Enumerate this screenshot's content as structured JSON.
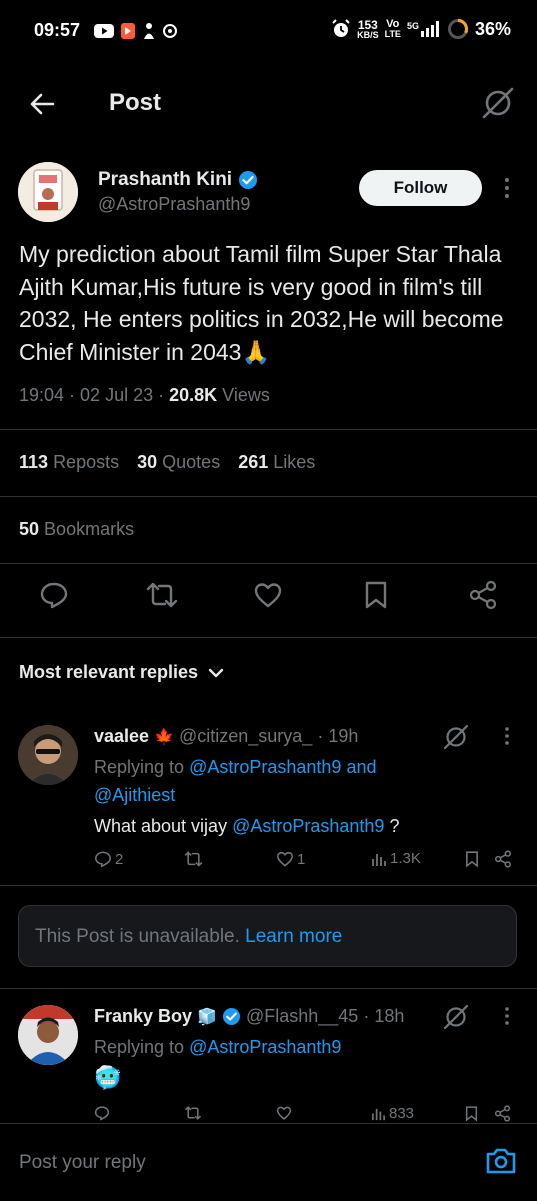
{
  "status_bar": {
    "time": "09:57",
    "net_speed_value": "153",
    "net_speed_unit": "KB/S",
    "volte_top": "Vo",
    "volte_bottom": "LTE",
    "network": "5G",
    "battery": "36%"
  },
  "header": {
    "title": "Post"
  },
  "post": {
    "author_name": "Prashanth Kini",
    "author_handle": "@AstroPrashanth9",
    "follow_label": "Follow",
    "text": "My prediction about Tamil film Super Star Thala Ajith Kumar,His future is very good in film's till 2032, He enters politics in 2032,He will become Chief Minister in 2043",
    "emoji": "🙏",
    "time": "19:04",
    "date": "02 Jul 23",
    "views_count": "20.8K",
    "views_label": "Views",
    "reposts_count": "113",
    "reposts_label": "Reposts",
    "quotes_count": "30",
    "quotes_label": "Quotes",
    "likes_count": "261",
    "likes_label": "Likes",
    "bookmarks_count": "50",
    "bookmarks_label": "Bookmarks"
  },
  "replies_sort": {
    "label": "Most relevant replies"
  },
  "replies": [
    {
      "name": "vaalee",
      "name_emoji": "🍁",
      "handle": "@citizen_surya_",
      "age": "19h",
      "replying_prefix": "Replying to",
      "replying_to_1": "@AstroPrashanth9",
      "replying_and": "and",
      "replying_to_2": "@Ajithiest",
      "text_before": "What about vijay",
      "mention": "@AstroPrashanth9",
      "text_after": "?",
      "comments": "2",
      "likes": "1",
      "views": "1.3K"
    },
    {
      "name": "Franky Boy",
      "name_emoji": "🧊",
      "handle": "@Flashh__45",
      "age": "18h",
      "replying_prefix": "Replying to",
      "replying_to_1": "@AstroPrashanth9",
      "emoji": "🥶",
      "views": "833"
    }
  ],
  "unavailable": {
    "text": "This Post is unavailable.",
    "link": "Learn more"
  },
  "compose": {
    "placeholder": "Post your reply"
  },
  "colors": {
    "background": "#000000",
    "accent": "#1d9bf0",
    "muted": "#71767b",
    "divider": "#2f3336"
  }
}
